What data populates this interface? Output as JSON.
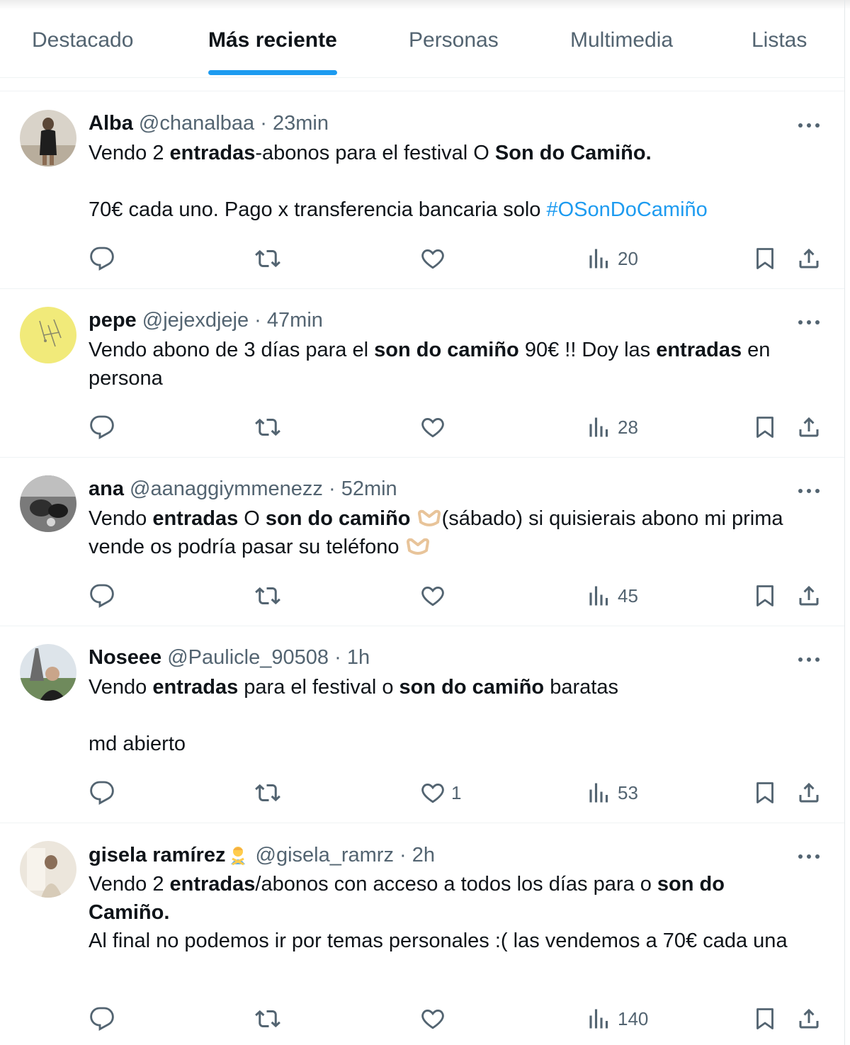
{
  "tabs": [
    {
      "label": "Destacado"
    },
    {
      "label": "Más reciente",
      "active": true
    },
    {
      "label": "Personas"
    },
    {
      "label": "Multimedia"
    },
    {
      "label": "Listas"
    }
  ],
  "colors": {
    "accent": "#1d9bf0",
    "text": "#0f1419",
    "muted": "#536471",
    "divider": "#eff3f4"
  },
  "tweets": [
    {
      "name": "Alba",
      "handle": "@chanalbaa",
      "separator": "·",
      "time": "23min",
      "text": {
        "l1a": "Vendo 2 ",
        "l1b": "entradas",
        "l1c": "-abonos para el festival O ",
        "l1d": "Son do Camiño.",
        "l2a": "70€ cada uno. Pago x transferencia bancaria solo ",
        "hashtag": "#OSonDoCamiño"
      },
      "views": "20",
      "likes": ""
    },
    {
      "name": "pepe",
      "handle": "@jejexdjeje",
      "separator": "·",
      "time": "47min",
      "text": {
        "a": "Vendo abono de 3 días para el ",
        "b": "son do camiño",
        "c": " 90€ !! Doy las ",
        "d": "entradas",
        "e": " en persona"
      },
      "views": "28",
      "likes": ""
    },
    {
      "name": "ana",
      "handle": "@aanaggiymmenezz",
      "separator": "·",
      "time": "52min",
      "text": {
        "a": "Vendo ",
        "b": "entradas",
        "c": " O ",
        "d": "son do camiño",
        "e": "(sábado) si quisierais abono mi prima vende os podría pasar su teléfono",
        "emoji": "heart-hands-emoji"
      },
      "views": "45",
      "likes": ""
    },
    {
      "name": "Noseee",
      "handle": "@Paulicle_90508",
      "separator": "·",
      "time": "1h",
      "text": {
        "a": "Vendo ",
        "b": "entradas",
        "c": " para el festival o ",
        "d": "son do camiño",
        "e": " baratas",
        "l2": "md abierto"
      },
      "views": "53",
      "likes": "1"
    },
    {
      "name": "gisela ramírez",
      "name_emoji": "person-gesturing-no-emoji",
      "handle": "@gisela_ramrz",
      "separator": "·",
      "time": "2h",
      "text": {
        "a": "Vendo 2 ",
        "b": "entradas",
        "c": "/abonos con acceso a todos los días para o ",
        "d": "son do Camiño.",
        "l2": "Al final no podemos ir por temas personales :( las vendemos a 70€ cada una"
      },
      "views": "140",
      "likes": ""
    }
  ],
  "icons": {
    "reply": "reply-icon",
    "retweet": "retweet-icon",
    "like": "heart-icon",
    "views": "views-chart-icon",
    "bookmark": "bookmark-icon",
    "share": "share-icon",
    "more": "more-dots-icon"
  }
}
